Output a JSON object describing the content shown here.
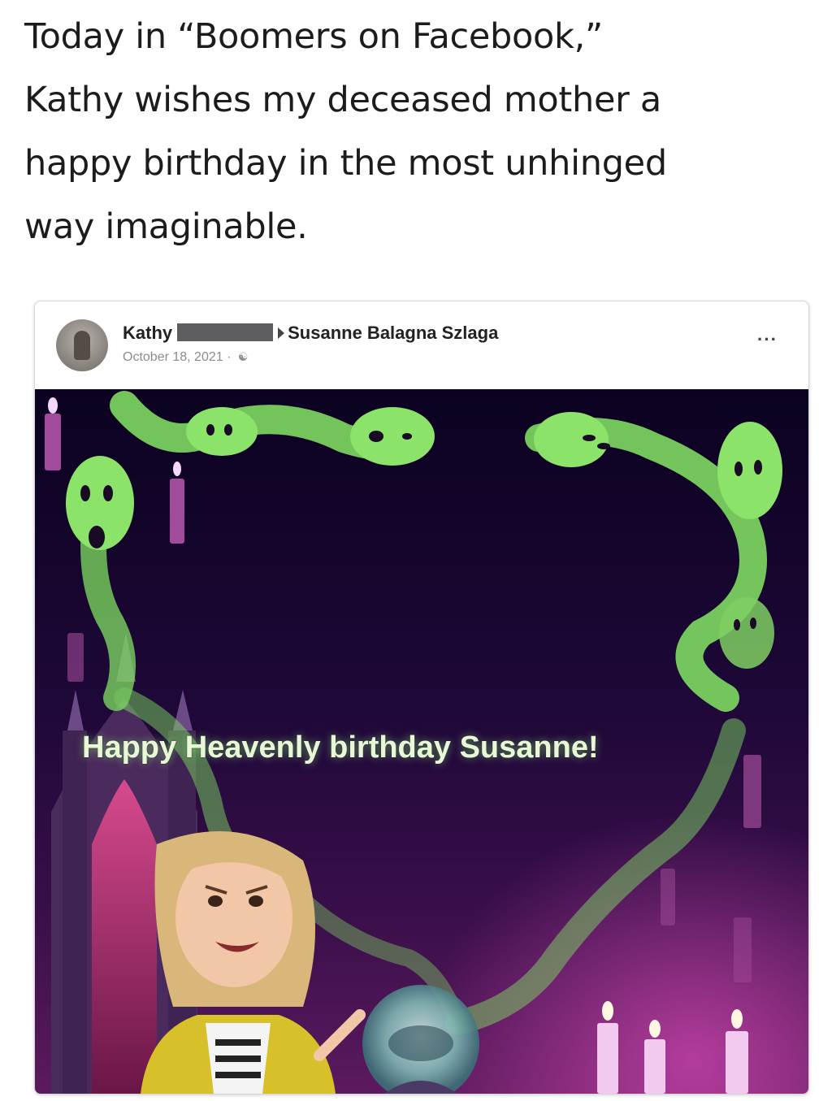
{
  "caption": {
    "line1": "Today in “Boomers on Facebook,”",
    "line2": "Kathy wishes my deceased mother a",
    "line3": "happy birthday in the most unhinged",
    "line4": "way imaginable."
  },
  "post": {
    "author": "Kathy",
    "recipient": "Susanne Balagna Szlaga",
    "date": "October 18, 2021 ·",
    "audience_icon": "friends-icon",
    "more_label": "···",
    "image_text": "Happy Heavenly birthday Susanne!"
  },
  "colors": {
    "caption_text": "#1c1c1c",
    "date_text": "#8a8d91",
    "image_bg_top": "#0c0320",
    "image_bg_bottom": "#5a1a5e",
    "ghost_green": "#8be36a",
    "banner_text": "#e9f7d8"
  }
}
